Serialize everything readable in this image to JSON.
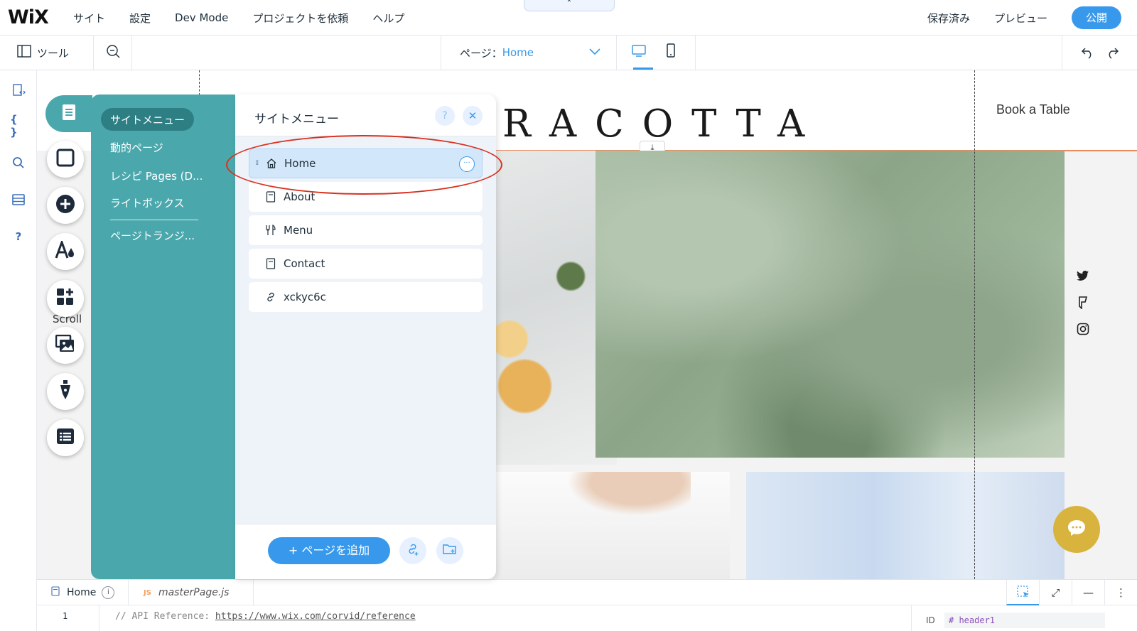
{
  "topbar": {
    "logo": "WiX",
    "nav": [
      "サイト",
      "設定",
      "Dev Mode",
      "プロジェクトを依頼",
      "ヘルプ"
    ],
    "collapse_glyph": "⌃",
    "saved": "保存済み",
    "preview": "プレビュー",
    "publish": "公開"
  },
  "toolbar": {
    "tools_label": "ツール",
    "page_prefix": "ページ：",
    "page_value": "Home"
  },
  "left_strip_icons": [
    "page-code-icon",
    "braces-icon",
    "search-icon",
    "database-icon",
    "help-icon"
  ],
  "site_preview": {
    "brand_word": "RACOTTA",
    "book_table": "Book a Table",
    "scroll_label": "Scroll"
  },
  "pages_panel": {
    "left_items": [
      "サイトメニュー",
      "動的ページ",
      "レシピ Pages (D...",
      "ライトボックス",
      "ページトランジ..."
    ],
    "title": "サイトメニュー",
    "help": "?",
    "close": "✕",
    "pages": [
      {
        "label": "Home",
        "icon": "home-icon"
      },
      {
        "label": "About",
        "icon": "page-icon"
      },
      {
        "label": "Menu",
        "icon": "fork-knife-icon"
      },
      {
        "label": "Contact",
        "icon": "page-icon"
      },
      {
        "label": "xckyc6c",
        "icon": "link-icon"
      }
    ],
    "more_glyph": "···",
    "add_page": "+ ページを追加"
  },
  "code_panel": {
    "tab_home": "Home",
    "tab_home_badge": "i",
    "tab_js_badge": "JS",
    "tab_master": "masterPage.js",
    "line_number": "1",
    "comment_prefix": "// API Reference: ",
    "comment_link": "https://www.wix.com/corvid/reference",
    "id_label": "ID",
    "id_value": "# header1"
  },
  "colors": {
    "accent": "#3899ec",
    "panel_teal": "#4aa8ad",
    "panel_teal_dark": "#2e7f84",
    "annotation_red": "#d9311f",
    "header_line": "#e98b5c",
    "chat_bubble": "#d8b33e"
  }
}
